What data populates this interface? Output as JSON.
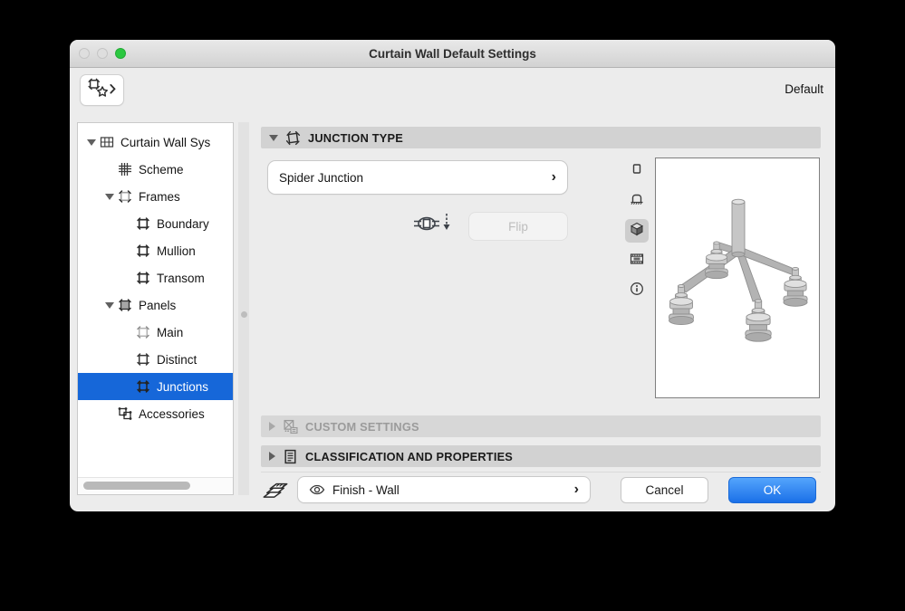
{
  "window": {
    "title": "Curtain Wall Default Settings",
    "toolbar": {
      "default_label": "Default"
    }
  },
  "tree": {
    "items": [
      {
        "label": "Curtain Wall Sys",
        "level": 0,
        "disclosure": "open",
        "icon": "curtain-wall-system-icon",
        "selected": false
      },
      {
        "label": "Scheme",
        "level": 1,
        "disclosure": "none",
        "icon": "scheme-grid-icon",
        "selected": false
      },
      {
        "label": "Frames",
        "level": 1,
        "disclosure": "open",
        "icon": "frame-outline-icon",
        "selected": false
      },
      {
        "label": "Boundary",
        "level": 2,
        "disclosure": "none",
        "icon": "frame-icon",
        "selected": false
      },
      {
        "label": "Mullion",
        "level": 2,
        "disclosure": "none",
        "icon": "frame-icon",
        "selected": false
      },
      {
        "label": "Transom",
        "level": 2,
        "disclosure": "none",
        "icon": "frame-icon",
        "selected": false
      },
      {
        "label": "Panels",
        "level": 1,
        "disclosure": "open",
        "icon": "panel-filled-icon",
        "selected": false
      },
      {
        "label": "Main",
        "level": 2,
        "disclosure": "none",
        "icon": "panel-light-icon",
        "selected": false
      },
      {
        "label": "Distinct",
        "level": 2,
        "disclosure": "none",
        "icon": "panel-dark-icon",
        "selected": false
      },
      {
        "label": "Junctions",
        "level": 2,
        "disclosure": "none",
        "icon": "junction-icon",
        "selected": true
      },
      {
        "label": "Accessories",
        "level": 1,
        "disclosure": "none",
        "icon": "accessories-icon",
        "selected": false
      }
    ]
  },
  "junction_panel": {
    "section_title": "JUNCTION TYPE",
    "junction_type_value": "Spider Junction",
    "flip_button_label": "Flip",
    "view_modes": [
      "symbol-2d",
      "elevation",
      "3d",
      "preview-image",
      "info"
    ],
    "selected_view_mode": "3d"
  },
  "collapsed_sections": [
    {
      "title": "CUSTOM SETTINGS",
      "enabled": false
    },
    {
      "title": "CLASSIFICATION AND PROPERTIES",
      "enabled": true
    }
  ],
  "footer": {
    "layer_value": "Finish - Wall",
    "cancel_label": "Cancel",
    "ok_label": "OK"
  },
  "colors": {
    "selection_blue": "#1667d9",
    "ok_button_top": "#54a5fc",
    "ok_button_bottom": "#1b70e8",
    "section_header_gray": "#d2d2d2",
    "traffic_green": "#2bc840"
  }
}
